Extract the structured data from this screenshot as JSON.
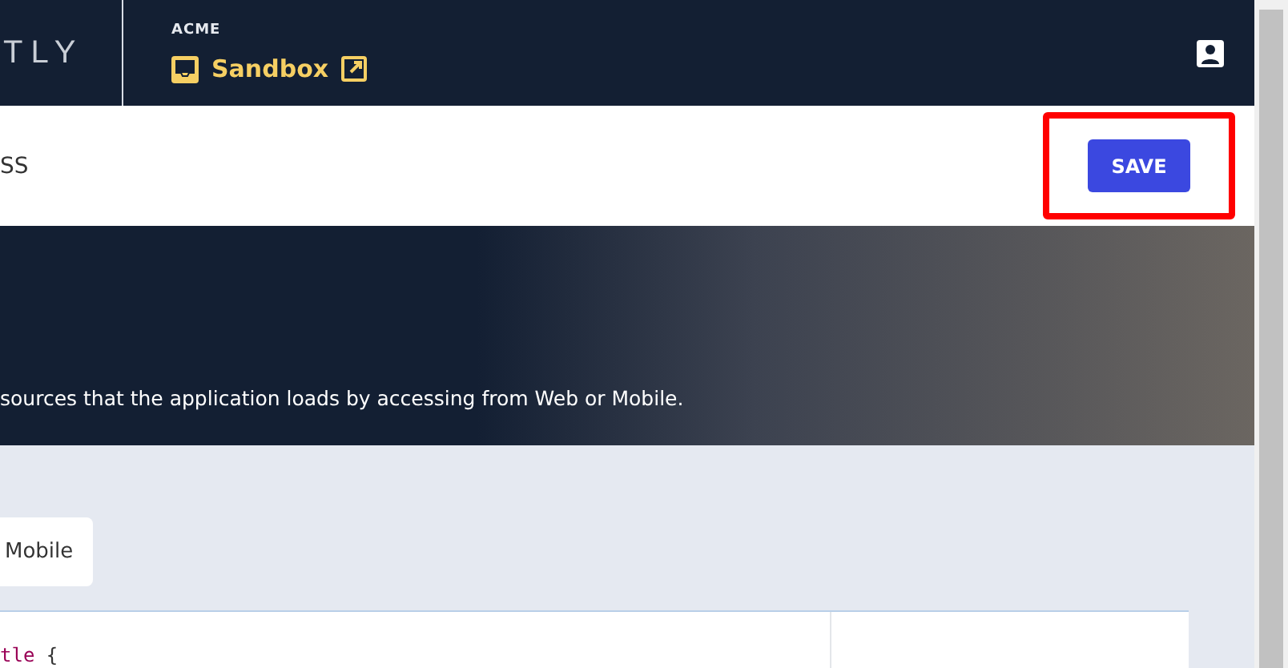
{
  "header": {
    "logo": "TLY",
    "org": "ACME",
    "tenant": "Sandbox"
  },
  "toolbar": {
    "title": "SS",
    "save_button": "SAVE",
    "save_highlighted": true
  },
  "banner": {
    "description": "sources that the application loads by accessing from Web or Mobile."
  },
  "tabs": [
    {
      "label": "Mobile",
      "selected": true
    }
  ],
  "code": {
    "selector": "tle",
    "brace": "{"
  }
}
